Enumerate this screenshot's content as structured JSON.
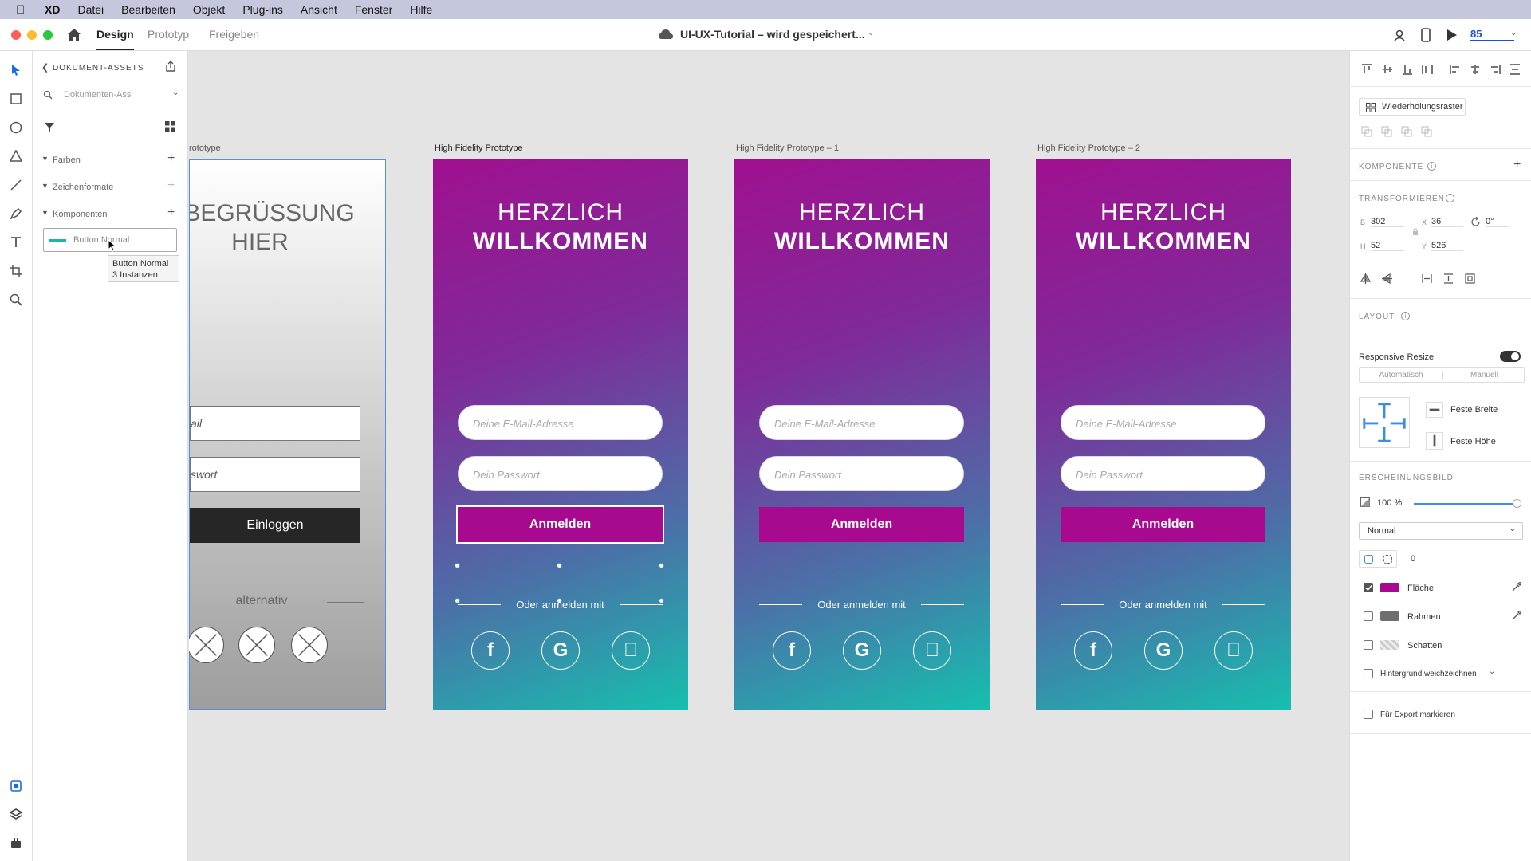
{
  "menubar": {
    "app": "XD",
    "items": [
      "Datei",
      "Bearbeiten",
      "Objekt",
      "Plug-ins",
      "Ansicht",
      "Fenster",
      "Hilfe"
    ]
  },
  "toolbar": {
    "tabs": [
      "Design",
      "Prototyp",
      "Freigeben"
    ],
    "doc_title": "UI-UX-Tutorial – wird gespeichert...",
    "zoom": "85"
  },
  "assets": {
    "title": "DOKUMENT-ASSETS",
    "search_placeholder": "Dokumenten-Ass",
    "sections": [
      "Farben",
      "Zeichenformate",
      "Komponenten"
    ],
    "component_name": "Button Normal",
    "tooltip_line1": "Button Normal",
    "tooltip_line2": "3 Instanzen"
  },
  "canvas": {
    "labels": [
      "rototype",
      "High Fidelity Prototype",
      "High Fidelity Prototype – 1",
      "High Fidelity Prototype – 2"
    ],
    "wireframe": {
      "title1": "BEGRÜSSUNG",
      "title2": "HIER",
      "email": "ail",
      "password": "swort",
      "login": "Einloggen",
      "alt": "alternativ"
    },
    "hifi": {
      "title1": "HERZLICH",
      "title2": "WILLKOMMEN",
      "email_placeholder": "Deine E-Mail-Adresse",
      "password_placeholder": "Dein Passwort",
      "button": "Anmelden",
      "oder": "Oder anmelden mit"
    },
    "colors": {
      "gradient_top": "#a0108f",
      "gradient_bottom": "#16bfae",
      "button": "#a80a8f"
    }
  },
  "rightpanel": {
    "repeat_grid": "Wiederholungsraster",
    "komponente": "KOMPONENTE",
    "transformieren": "TRANSFORMIEREN",
    "b_label": "B",
    "b": "302",
    "x_label": "X",
    "x": "36",
    "rot": "0°",
    "h_label": "H",
    "h": "52",
    "y_label": "Y",
    "y": "526",
    "layout": "LAYOUT",
    "responsive_resize": "Responsive Resize",
    "auto": "Automatisch",
    "manuell": "Manuell",
    "feste_breite": "Feste Breite",
    "feste_hoehe": "Feste Höhe",
    "erscheinungsbild": "ERSCHEINUNGSBILD",
    "opacity": "100 %",
    "blend": "Normal",
    "radius": "0",
    "flaeche": "Fläche",
    "rahmen": "Rahmen",
    "schatten": "Schatten",
    "hintergrund": "Hintergrund weichzeichnen",
    "export": "Für Export markieren"
  }
}
